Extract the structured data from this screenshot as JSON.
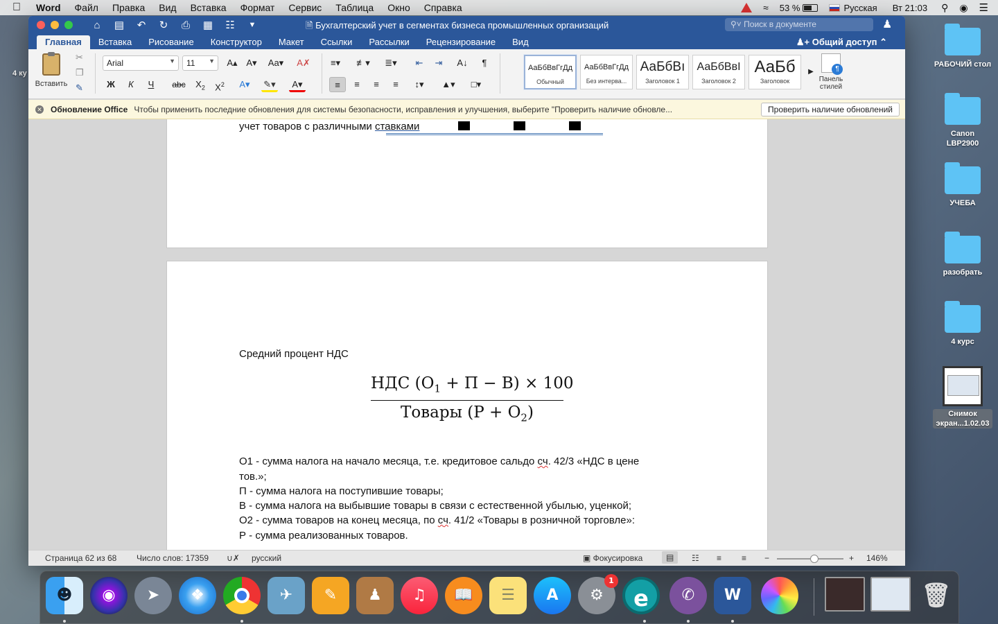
{
  "menubar": {
    "app": "Word",
    "items": [
      "Файл",
      "Правка",
      "Вид",
      "Вставка",
      "Формат",
      "Сервис",
      "Таблица",
      "Окно",
      "Справка"
    ],
    "battery": "53 %",
    "input_source": "Русская",
    "clock": "Вт 21:03"
  },
  "window": {
    "title": "Бухгалтерский учет в сегментах бизнеса промышленных организаций",
    "search_placeholder": "Поиск в документе",
    "tabs": [
      "Главная",
      "Вставка",
      "Рисование",
      "Конструктор",
      "Макет",
      "Ссылки",
      "Рассылки",
      "Рецензирование",
      "Вид"
    ],
    "active_tab": "Главная",
    "share": "Общий доступ"
  },
  "ribbon": {
    "paste_label": "Вставить",
    "font_name": "Arial",
    "font_size": "11",
    "bold": "Ж",
    "italic": "К",
    "underline": "Ч",
    "strike": "abc",
    "styles": [
      {
        "preview": "АаБбВвГгДд",
        "name": "Обычный"
      },
      {
        "preview": "АаБбВвГгДд",
        "name": "Без интерва..."
      },
      {
        "preview": "АаБбВı",
        "name": "Заголовок 1"
      },
      {
        "preview": "АаБбВвI",
        "name": "Заголовок 2"
      },
      {
        "preview": "АаБб",
        "name": "Заголовок"
      }
    ],
    "styles_pane": [
      "Панель",
      "стилей"
    ]
  },
  "infobar": {
    "title": "Обновление Office",
    "message": "Чтобы применить последние обновления для системы безопасности, исправления и улучшения, выберите \"Проверить наличие обновле...",
    "button": "Проверить наличие обновлений"
  },
  "document": {
    "top_line_prefix": "учет товаров с различными ",
    "top_line_link": "ставками",
    "heading": "Средний процент НДС",
    "formula": {
      "num_a": "НДС (О",
      "num_sub": "1",
      "num_b": " + П − В) × 100",
      "den_a": "Товары (Р + О",
      "den_sub": "2",
      "den_b": ")"
    },
    "line1_a": "О1 - сумма налога на начало месяца, т.е. кредитовое сальдо ",
    "line1_sq": "сч",
    "line1_b": ". 42/3 «НДС в цене",
    "line2": "тов.»;",
    "line3": "П - сумма налога на поступившие товары;",
    "line4": "В - сумма налога на выбывшие товары в связи с естественной убылью, уценкой;",
    "line5_a": "О2 - сумма товаров на конец месяца, по ",
    "line5_sq": "сч",
    "line5_b": ". 41/2 «Товары в розничной торговле»:",
    "line6": "Р - сумма реализованных товаров."
  },
  "status": {
    "page": "Страница 62 из 68",
    "words": "Число слов: 17359",
    "language": "русский",
    "focus": "Фокусировка",
    "zoom": "146%"
  },
  "desktop": {
    "left_label": "4 ку",
    "items": [
      "РАБОЧИЙ стол",
      "Canon LBP2900",
      "УЧЕБА",
      "разобрать",
      "4 курс",
      "Снимок экран...1.02.03"
    ]
  },
  "dock": {
    "settings_badge": "1",
    "word_letter": "W",
    "eset_letter": "e"
  }
}
